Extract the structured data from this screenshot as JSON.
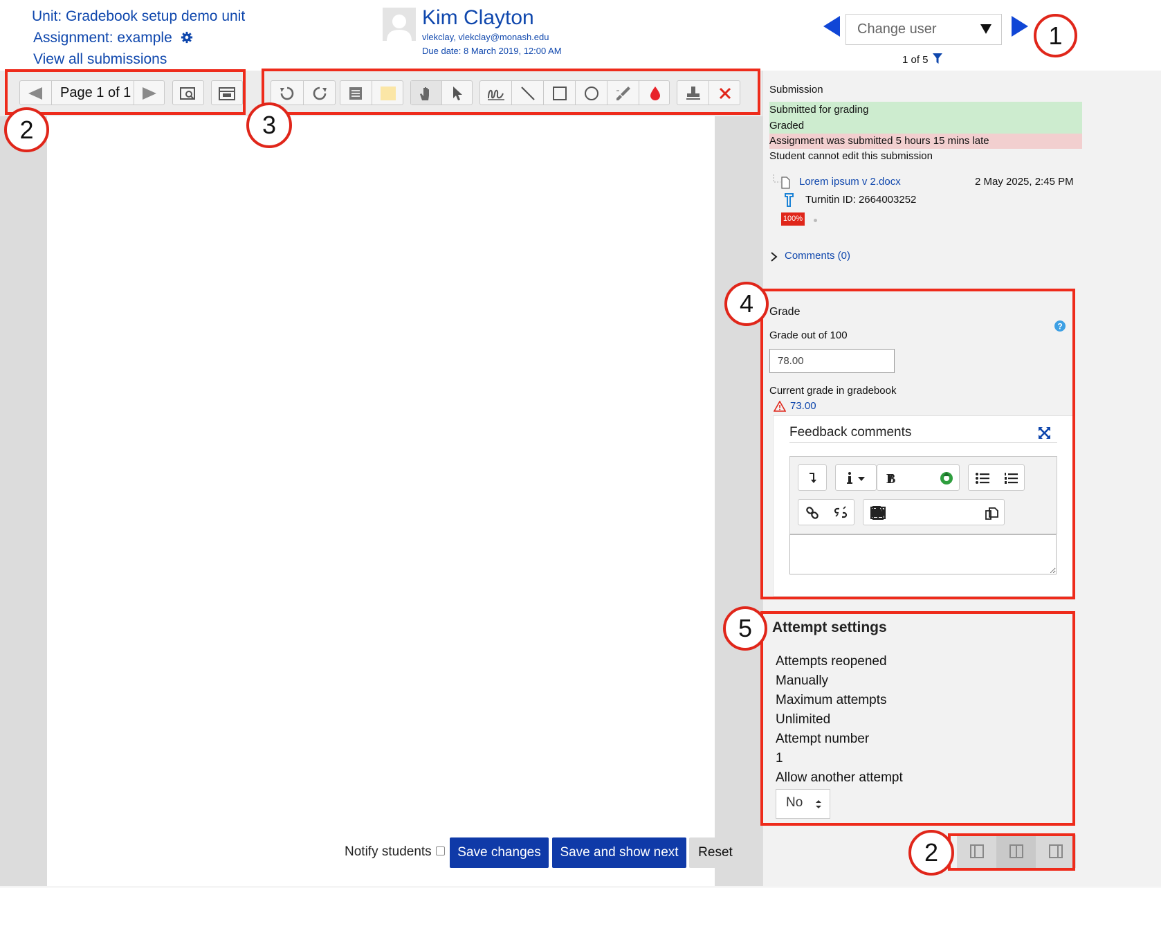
{
  "header": {
    "unit_link": "Unit: Gradebook setup demo unit",
    "assignment_link": "Assignment: example",
    "view_all_link": "View all submissions",
    "user_name": "Kim Clayton",
    "user_email": "vlekclay, vlekclay@monash.edu",
    "due_date": "Due date: 8 March 2019, 12:00 AM",
    "change_user_placeholder": "Change user",
    "user_count": "1 of 5"
  },
  "callouts": {
    "one": "1",
    "two": "2",
    "three": "3",
    "four": "4",
    "five": "5"
  },
  "doc_toolbar": {
    "page_label": "Page 1 of 1"
  },
  "submission": {
    "heading": "Submission",
    "status_submitted": "Submitted for grading",
    "status_graded": "Graded",
    "status_late": "Assignment was submitted 5 hours 15 mins late",
    "status_edit": "Student cannot edit this submission",
    "file_name": "Lorem ipsum v 2.docx",
    "file_date": "2 May 2025, 2:45 PM",
    "turnitin": "Turnitin ID: 2664003252",
    "similarity": "100%",
    "comments_link": "Comments (0)"
  },
  "grade": {
    "heading": "Grade",
    "label": "Grade out of 100",
    "value": "78.00",
    "current_label": "Current grade in gradebook",
    "current_value": "73.00",
    "feedback_heading": "Feedback comments"
  },
  "attempt": {
    "heading": "Attempt settings",
    "reopened_label": "Attempts reopened",
    "reopened_value": "Manually",
    "max_label": "Maximum attempts",
    "max_value": "Unlimited",
    "number_label": "Attempt number",
    "number_value": "1",
    "allow_label": "Allow another attempt",
    "allow_value": "No"
  },
  "footer": {
    "notify_label": "Notify students",
    "save_label": "Save changes",
    "save_next_label": "Save and show next",
    "reset_label": "Reset"
  },
  "colors": {
    "link": "#0f47ad",
    "primary_button": "#0f3aa8",
    "callout_red": "#e0261a",
    "status_green": "#cdeccf",
    "status_red": "#f2cfcf"
  }
}
